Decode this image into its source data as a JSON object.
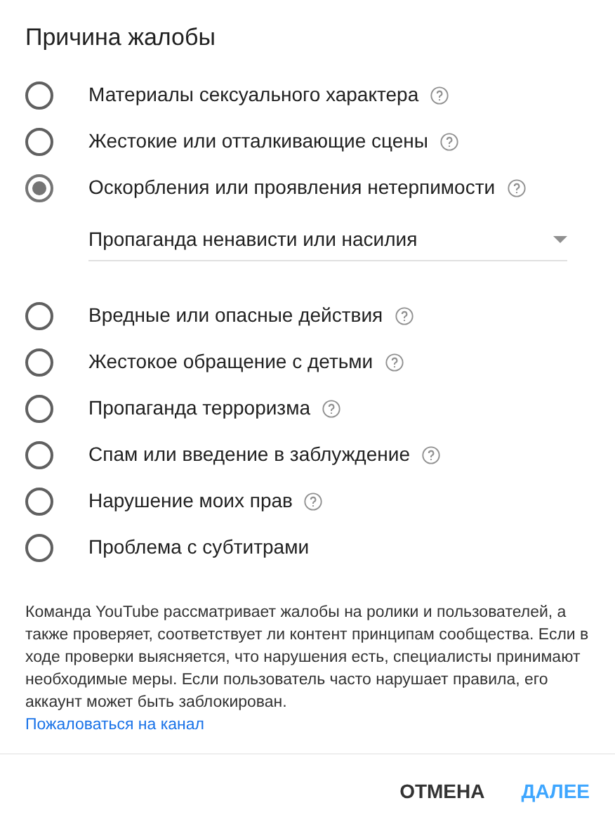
{
  "title": "Причина жалобы",
  "options": [
    {
      "label": "Материалы сексуального характера",
      "selected": false,
      "help": true
    },
    {
      "label": "Жестокие или отталкивающие сцены",
      "selected": false,
      "help": true
    },
    {
      "label": "Оскорбления или проявления нетерпимости",
      "selected": true,
      "help": true,
      "dropdown": {
        "value": "Пропаганда ненависти или насилия"
      }
    },
    {
      "label": "Вредные или опасные действия",
      "selected": false,
      "help": true
    },
    {
      "label": "Жестокое обращение с детьми",
      "selected": false,
      "help": true
    },
    {
      "label": "Пропаганда терроризма",
      "selected": false,
      "help": true
    },
    {
      "label": "Спам или введение в заблуждение",
      "selected": false,
      "help": true
    },
    {
      "label": "Нарушение моих прав",
      "selected": false,
      "help": true
    },
    {
      "label": "Проблема с субтитрами",
      "selected": false,
      "help": false
    }
  ],
  "description": "Команда YouTube рассматривает жалобы на ролики и пользователей, а также проверяет, соответствует ли контент принципам сообщества. Если в ходе проверки выясняется, что нарушения есть, специалисты принимают необходимые меры. Если пользователь часто нарушает правила, его аккаунт может быть заблокирован.",
  "link": "Пожаловаться на канал",
  "buttons": [
    {
      "label": "ОТМЕНА",
      "kind": "secondary"
    },
    {
      "label": "ДАЛЕЕ",
      "kind": "primary"
    }
  ]
}
